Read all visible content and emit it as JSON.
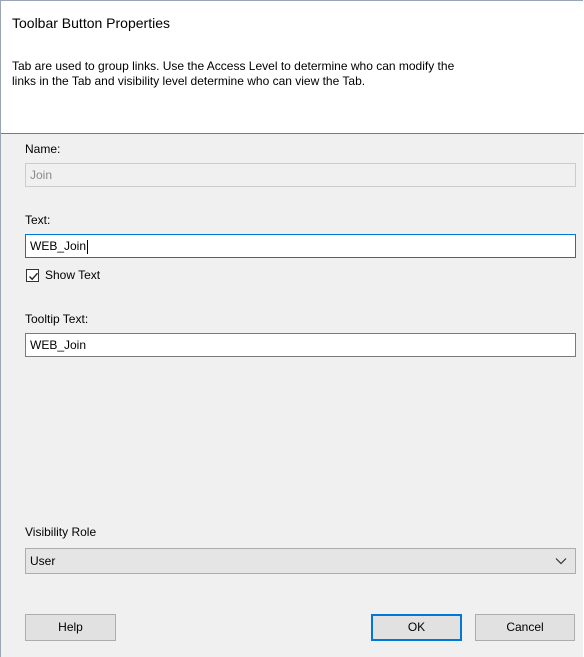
{
  "dialog": {
    "title": "Toolbar Button Properties",
    "description_line1": "Tab are used to group links. Use the Access Level to determine who can modify the",
    "description_line2": "links in the Tab and visibility  level  determine who can view the Tab."
  },
  "form": {
    "name_label": "Name:",
    "name_value": "Join",
    "text_label": "Text:",
    "text_value": "WEB_Join",
    "show_text_label": "Show Text",
    "show_text_checked": true,
    "tooltip_label": "Tooltip Text:",
    "tooltip_value": "WEB_Join",
    "visibility_label": "Visibility Role",
    "visibility_value": "User"
  },
  "buttons": {
    "help": "Help",
    "ok": "OK",
    "cancel": "Cancel"
  },
  "colors": {
    "accent": "#0078d7",
    "dialog_bg": "#f0f0f0"
  },
  "icons": {
    "checkbox_check": "check-icon",
    "dropdown": "chevron-down-icon"
  }
}
